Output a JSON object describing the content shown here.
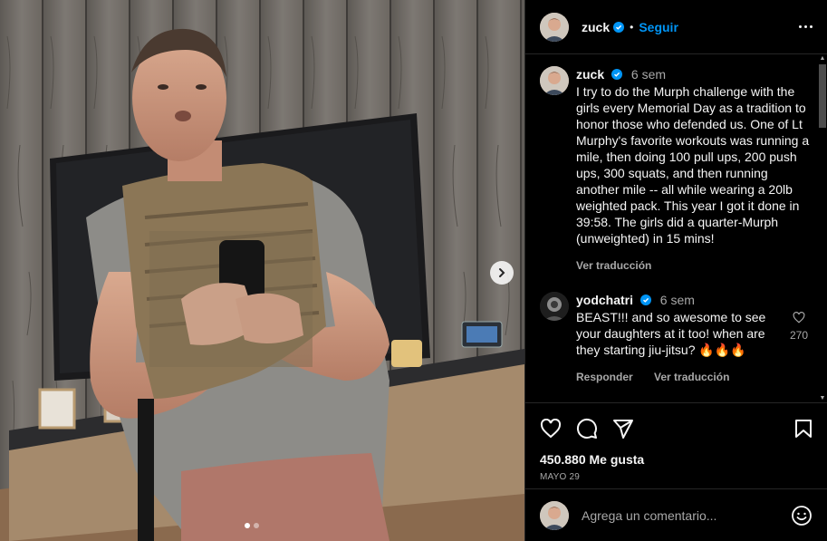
{
  "post": {
    "author": "zuck",
    "follow_label": "Seguir",
    "separator": "•"
  },
  "caption": {
    "username": "zuck",
    "time": "6 sem",
    "text": "I try to do the Murph challenge with the girls every Memorial Day as a tradition to honor those who defended us. One of Lt Murphy's favorite workouts was running a mile, then doing 100 pull ups, 200 push ups, 300 squats, and then running another mile -- all while wearing a 20lb weighted pack. This year I got it done in 39:58. The girls did a quarter-Murph (unweighted) in 15 mins!",
    "translate": "Ver traducción"
  },
  "comments": [
    {
      "username": "yodchatri",
      "time": "6 sem",
      "text": "BEAST!!! and so awesome to see your daughters at it too! when are they starting jiu-jitsu? 🔥🔥🔥",
      "likes": "270",
      "reply": "Responder",
      "translate": "Ver traducción"
    }
  ],
  "stats": {
    "likes": "450.880 Me gusta",
    "date": "MAYO 29"
  },
  "add_comment": {
    "placeholder": "Agrega un comentario..."
  },
  "carousel": {
    "current": 1,
    "total": 2
  },
  "icons": {
    "verified": "verified-badge-icon",
    "more": "more-options-icon",
    "like": "heart-icon",
    "comment": "comment-icon",
    "share": "send-icon",
    "save": "bookmark-icon",
    "emoji": "emoji-icon",
    "next": "chevron-right-icon"
  },
  "colors": {
    "accent": "#0095f6",
    "background": "#000000",
    "muted": "#a8a8a8"
  }
}
